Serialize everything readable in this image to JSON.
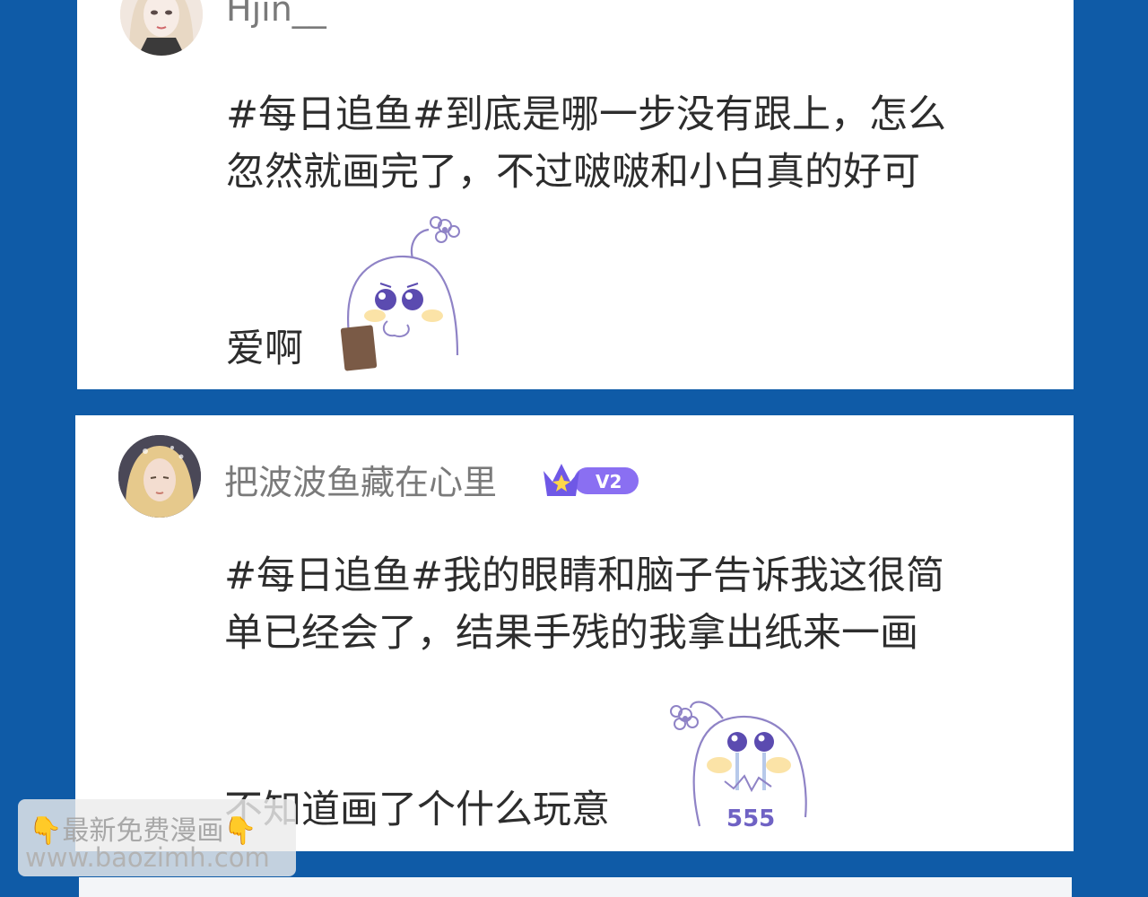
{
  "comments": [
    {
      "username": "Hjin__",
      "lines": [
        "#每日追鱼#到底是哪一步没有跟上，怎么",
        "忽然就画完了，不过啵啵和小白真的好可",
        "爱啊"
      ],
      "sticker_icon": "crying-ghost-holding-tablet-sticker"
    },
    {
      "username": "把波波鱼藏在心里",
      "badge": "V2",
      "lines": [
        "#每日追鱼#我的眼睛和脑子告诉我这很简",
        "单已经会了，结果手残的我拿出纸来一画",
        "不知道画了个什么玩意"
      ],
      "sticker_text": "555",
      "sticker_icon": "crying-ghost-flower-sticker"
    }
  ],
  "watermark": {
    "hand_icon": "👇",
    "line1": "最新免费漫画",
    "line2": "www.baozimh.com"
  },
  "colors": {
    "background": "#0f5ba7",
    "card": "#ffffff",
    "badge": "#7b5cf0"
  }
}
